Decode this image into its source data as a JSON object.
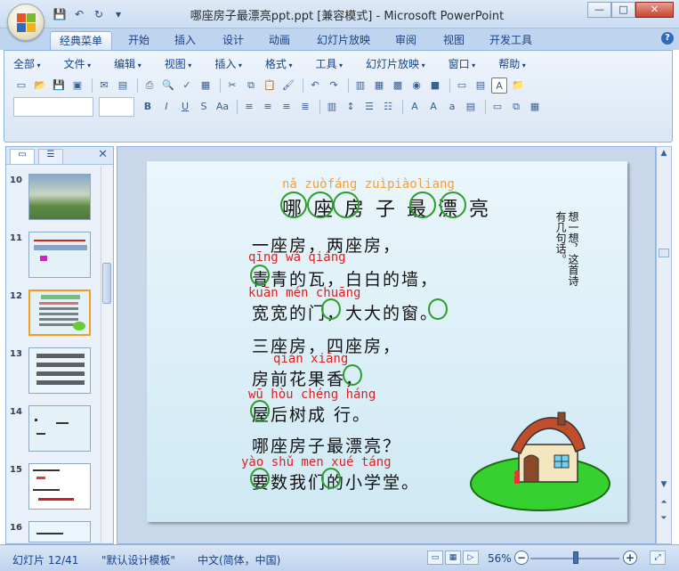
{
  "window": {
    "title": "哪座房子最漂亮ppt.ppt [兼容模式] - Microsoft PowerPoint",
    "controls": [
      "—",
      "□",
      "✕"
    ]
  },
  "ribbon": {
    "tabs": [
      "经典菜单",
      "开始",
      "插入",
      "设计",
      "动画",
      "幻灯片放映",
      "审阅",
      "视图",
      "开发工具"
    ],
    "active_tab": "经典菜单",
    "menus": [
      "全部",
      "文件",
      "编辑",
      "视图",
      "插入",
      "格式",
      "工具",
      "幻灯片放映",
      "窗口",
      "帮助"
    ]
  },
  "thumbnails": [
    {
      "num": "10",
      "type": "photo"
    },
    {
      "num": "11",
      "type": "text"
    },
    {
      "num": "12",
      "type": "current"
    },
    {
      "num": "13",
      "type": "grid"
    },
    {
      "num": "14",
      "type": "sparse"
    },
    {
      "num": "15",
      "type": "pinyin"
    },
    {
      "num": "16",
      "type": "partial"
    }
  ],
  "slide": {
    "title_pinyin": [
      "nǎ",
      "zuò",
      "fáng",
      "zuì",
      "piào",
      "liang"
    ],
    "title_pinyin_display": "nǎ zuòfáng  zuìpiàoliang",
    "title": "哪座房子最漂亮",
    "title_display": "哪 座 房 子 最 漂 亮",
    "side_note": [
      "想一想，这首诗",
      "有几句话。"
    ],
    "lines": [
      {
        "text": "一座房，两座房，",
        "pinyin": ""
      },
      {
        "text": "青青的瓦，白白的墙，",
        "pinyin": "qīng                   wǎ                        qiáng"
      },
      {
        "text": "宽宽的门，大大的窗。",
        "pinyin": "kuān          mén            chuāng"
      },
      {
        "text": "三座房，四座房，",
        "pinyin": ""
      },
      {
        "text": "房前花果香，",
        "pinyin": "qián   xiāng"
      },
      {
        "text": "屋后树成     行。",
        "pinyin": "wū hòu  chéng   háng"
      },
      {
        "text": "哪座房子最漂亮？",
        "pinyin": ""
      },
      {
        "text": "要数我们的小学堂。",
        "pinyin": "yào shǔ   men     xué táng"
      }
    ]
  },
  "statusbar": {
    "slide_counter": "幻灯片 12/41",
    "template": "\"默认设计模板\"",
    "language": "中文(简体，中国)",
    "zoom": "56%",
    "zoom_value": 56
  }
}
